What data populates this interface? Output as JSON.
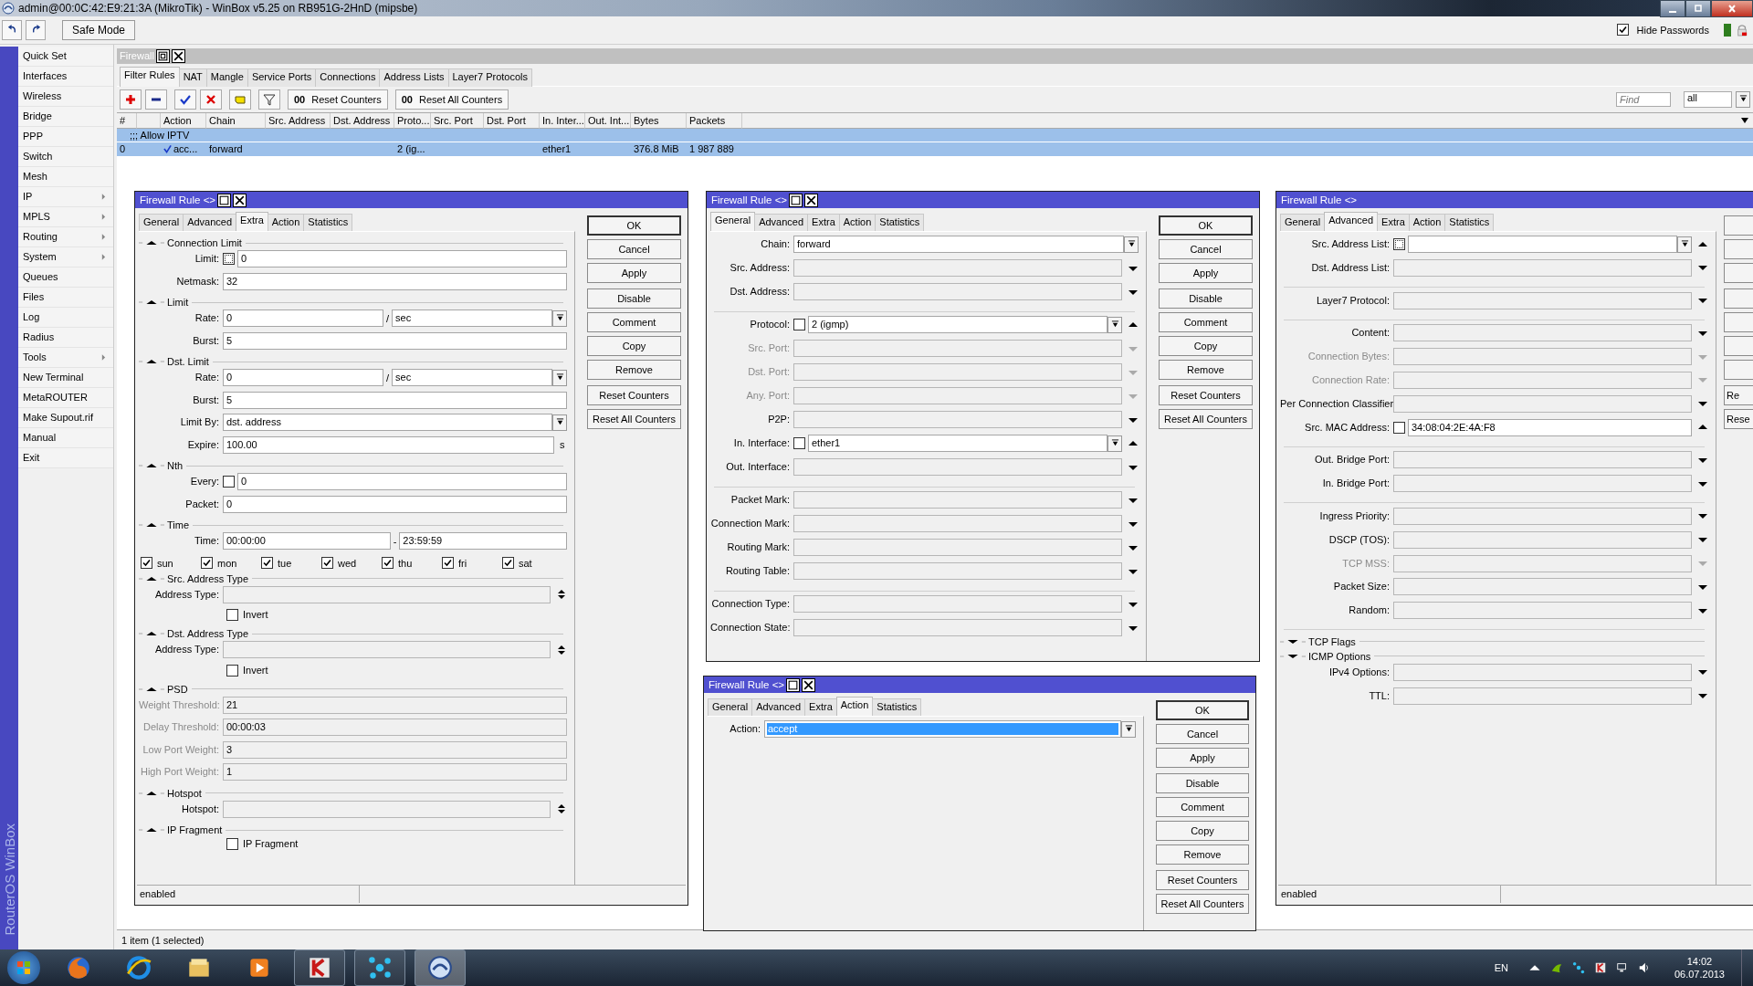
{
  "app_window": {
    "title": "admin@00:0C:42:E9:21:3A (MikroTik) - WinBox v5.25 on RB951G-2HnD (mipsbe)"
  },
  "toolbar": {
    "safe_mode": "Safe Mode",
    "hide_passwords": {
      "label": "Hide Passwords",
      "checked": true
    }
  },
  "sidebar": {
    "brand": "RouterOS WinBox",
    "items": [
      {
        "label": "Quick Set",
        "submenu": false
      },
      {
        "label": "Interfaces",
        "submenu": false
      },
      {
        "label": "Wireless",
        "submenu": false
      },
      {
        "label": "Bridge",
        "submenu": false
      },
      {
        "label": "PPP",
        "submenu": false
      },
      {
        "label": "Switch",
        "submenu": false
      },
      {
        "label": "Mesh",
        "submenu": false
      },
      {
        "label": "IP",
        "submenu": true
      },
      {
        "label": "MPLS",
        "submenu": true
      },
      {
        "label": "Routing",
        "submenu": true
      },
      {
        "label": "System",
        "submenu": true
      },
      {
        "label": "Queues",
        "submenu": false
      },
      {
        "label": "Files",
        "submenu": false
      },
      {
        "label": "Log",
        "submenu": false
      },
      {
        "label": "Radius",
        "submenu": false
      },
      {
        "label": "Tools",
        "submenu": true
      },
      {
        "label": "New Terminal",
        "submenu": false
      },
      {
        "label": "MetaROUTER",
        "submenu": false
      },
      {
        "label": "Make Supout.rif",
        "submenu": false
      },
      {
        "label": "Manual",
        "submenu": false
      },
      {
        "label": "Exit",
        "submenu": false
      }
    ]
  },
  "firewall": {
    "title": "Firewall",
    "tabs": [
      {
        "label": "Filter Rules",
        "selected": true
      },
      {
        "label": "NAT",
        "selected": false
      },
      {
        "label": "Mangle",
        "selected": false
      },
      {
        "label": "Service Ports",
        "selected": false
      },
      {
        "label": "Connections",
        "selected": false
      },
      {
        "label": "Address Lists",
        "selected": false
      },
      {
        "label": "Layer7 Protocols",
        "selected": false
      }
    ],
    "counter_buttons": [
      {
        "icon_text": "00",
        "label": "Reset Counters"
      },
      {
        "icon_text": "00",
        "label": "Reset All Counters"
      }
    ],
    "find": {
      "placeholder": "Find"
    },
    "filter": "all",
    "table": {
      "columns": [
        "#",
        null,
        "Action",
        "Chain",
        "Src. Address",
        "Dst. Address",
        "Proto...",
        "Src. Port",
        "Dst. Port",
        "In. Inter...",
        "Out. Int...",
        "Bytes",
        "Packets"
      ],
      "rows": [
        {
          "comment": ";;; Allow IPTV",
          "selected": true,
          "cells": [
            "0",
            null,
            "acc...",
            "forward",
            null,
            null,
            "2 (ig...",
            null,
            null,
            "ether1",
            null,
            "376.8 MiB",
            "1 987 889"
          ]
        }
      ]
    },
    "status": "1 item (1 selected)"
  },
  "dialogs": [
    {
      "title": "Firewall Rule <>",
      "clipped": false,
      "tabs": [
        {
          "label": "General",
          "selected": false
        },
        {
          "label": "Advanced",
          "selected": false
        },
        {
          "label": "Extra",
          "selected": true
        },
        {
          "label": "Action",
          "selected": false
        },
        {
          "label": "Statistics",
          "selected": false
        }
      ],
      "rows": [
        {
          "kind": "section",
          "label": "Connection Limit",
          "expanded": true
        },
        {
          "kind": "field",
          "label": "Limit:",
          "invert": {
            "checked": false,
            "kind": "dotted"
          },
          "value": "0"
        },
        {
          "kind": "field",
          "label": "Netmask:",
          "value": "32"
        },
        {
          "kind": "section",
          "label": "Limit",
          "expanded": true
        },
        {
          "kind": "field",
          "label": "Rate:",
          "value": "0",
          "separator": "/",
          "value2": "sec",
          "dropdown": true
        },
        {
          "kind": "field",
          "label": "Burst:",
          "value": "5"
        },
        {
          "kind": "section",
          "label": "Dst. Limit",
          "expanded": true
        },
        {
          "kind": "field",
          "label": "Rate:",
          "value": "0",
          "separator": "/",
          "value2": "sec",
          "dropdown": true
        },
        {
          "kind": "field",
          "label": "Burst:",
          "value": "5"
        },
        {
          "kind": "field",
          "label": "Limit By:",
          "value": "dst. address",
          "dropdown": true
        },
        {
          "kind": "field",
          "label": "Expire:",
          "value": "100.00",
          "unit": "s"
        },
        {
          "kind": "section",
          "label": "Nth",
          "expanded": true
        },
        {
          "kind": "field",
          "label": "Every:",
          "invert": {
            "checked": false,
            "kind": "plain"
          },
          "value": "0"
        },
        {
          "kind": "field",
          "label": "Packet:",
          "value": "0"
        },
        {
          "kind": "section",
          "label": "Time",
          "expanded": true
        },
        {
          "kind": "field",
          "label": "Time:",
          "value": "00:00:00",
          "separator": "-",
          "value2": "23:59:59"
        },
        {
          "kind": "days",
          "days": [
            {
              "label": "sun",
              "checked": true
            },
            {
              "label": "mon",
              "checked": true
            },
            {
              "label": "tue",
              "checked": true
            },
            {
              "label": "wed",
              "checked": true
            },
            {
              "label": "thu",
              "checked": true
            },
            {
              "label": "fri",
              "checked": true
            },
            {
              "label": "sat",
              "checked": true
            }
          ]
        },
        {
          "kind": "section",
          "label": "Src. Address Type",
          "expanded": true
        },
        {
          "kind": "field",
          "label": "Address Type:",
          "arrow": {
            "kind": "updown"
          }
        },
        {
          "kind": "checkbox",
          "label": "Invert",
          "checked": false
        },
        {
          "kind": "section",
          "label": "Dst. Address Type",
          "expanded": true
        },
        {
          "kind": "field",
          "label": "Address Type:",
          "arrow": {
            "kind": "updown"
          }
        },
        {
          "kind": "checkbox",
          "label": "Invert",
          "checked": false
        },
        {
          "kind": "section",
          "label": "PSD",
          "expanded": true
        },
        {
          "kind": "field",
          "label": "Weight Threshold:",
          "value": "21",
          "disabled": true
        },
        {
          "kind": "field",
          "label": "Delay Threshold:",
          "value": "00:00:03",
          "disabled": true
        },
        {
          "kind": "field",
          "label": "Low Port Weight:",
          "value": "3",
          "disabled": true
        },
        {
          "kind": "field",
          "label": "High Port Weight:",
          "value": "1",
          "disabled": true
        },
        {
          "kind": "section",
          "label": "Hotspot",
          "expanded": true
        },
        {
          "kind": "field",
          "label": "Hotspot:",
          "arrow": {
            "kind": "updown"
          }
        },
        {
          "kind": "section",
          "label": "IP Fragment",
          "expanded": true
        },
        {
          "kind": "checkbox",
          "label": "IP Fragment",
          "checked": false
        }
      ],
      "button_groups": [
        [
          {
            "label": "OK"
          },
          {
            "label": "Cancel"
          },
          {
            "label": "Apply"
          }
        ],
        [
          {
            "label": "Disable"
          },
          {
            "label": "Comment"
          },
          {
            "label": "Copy"
          },
          {
            "label": "Remove"
          }
        ],
        [
          {
            "label": "Reset Counters"
          },
          {
            "label": "Reset All Counters"
          }
        ]
      ],
      "status": "enabled"
    },
    {
      "title": "Firewall Rule <>",
      "clipped": false,
      "tabs": [
        {
          "label": "General",
          "selected": true
        },
        {
          "label": "Advanced",
          "selected": false
        },
        {
          "label": "Extra",
          "selected": false
        },
        {
          "label": "Action",
          "selected": false
        },
        {
          "label": "Statistics",
          "selected": false
        }
      ],
      "rows": [
        {
          "kind": "field",
          "label": "Chain:",
          "value": "forward",
          "dropdown": true
        },
        {
          "kind": "field",
          "label": "Src. Address:",
          "arrow": {
            "kind": "down"
          }
        },
        {
          "kind": "field",
          "label": "Dst. Address:",
          "arrow": {
            "kind": "down"
          }
        },
        {
          "kind": "rule"
        },
        {
          "kind": "field",
          "label": "Protocol:",
          "invert": {
            "checked": false,
            "kind": "plain"
          },
          "value": "2 (igmp)",
          "dropdown": true,
          "arrow": {
            "kind": "up"
          }
        },
        {
          "kind": "field",
          "label": "Src. Port:",
          "arrow": {
            "kind": "down"
          },
          "disabled": true
        },
        {
          "kind": "field",
          "label": "Dst. Port:",
          "arrow": {
            "kind": "down"
          },
          "disabled": true
        },
        {
          "kind": "field",
          "label": "Any. Port:",
          "arrow": {
            "kind": "down"
          },
          "disabled": true
        },
        {
          "kind": "field",
          "label": "P2P:",
          "arrow": {
            "kind": "down"
          }
        },
        {
          "kind": "field",
          "label": "In. Interface:",
          "invert": {
            "checked": false,
            "kind": "plain"
          },
          "value": "ether1",
          "dropdown": true,
          "arrow": {
            "kind": "up"
          }
        },
        {
          "kind": "field",
          "label": "Out. Interface:",
          "arrow": {
            "kind": "down"
          }
        },
        {
          "kind": "rule"
        },
        {
          "kind": "field",
          "label": "Packet Mark:",
          "arrow": {
            "kind": "down"
          }
        },
        {
          "kind": "field",
          "label": "Connection Mark:",
          "arrow": {
            "kind": "down"
          }
        },
        {
          "kind": "field",
          "label": "Routing Mark:",
          "arrow": {
            "kind": "down"
          }
        },
        {
          "kind": "field",
          "label": "Routing Table:",
          "arrow": {
            "kind": "down"
          }
        },
        {
          "kind": "rule"
        },
        {
          "kind": "field",
          "label": "Connection Type:",
          "arrow": {
            "kind": "down"
          }
        },
        {
          "kind": "field",
          "label": "Connection State:",
          "arrow": {
            "kind": "down"
          }
        }
      ],
      "button_groups": [
        [
          {
            "label": "OK"
          },
          {
            "label": "Cancel"
          },
          {
            "label": "Apply"
          }
        ],
        [
          {
            "label": "Disable"
          },
          {
            "label": "Comment"
          },
          {
            "label": "Copy"
          },
          {
            "label": "Remove"
          }
        ],
        [
          {
            "label": "Reset Counters"
          },
          {
            "label": "Reset All Counters"
          }
        ]
      ]
    },
    {
      "title": "Firewall Rule <>",
      "clipped": true,
      "tabs": [
        {
          "label": "General",
          "selected": false
        },
        {
          "label": "Advanced",
          "selected": true
        },
        {
          "label": "Extra",
          "selected": false
        },
        {
          "label": "Action",
          "selected": false
        },
        {
          "label": "Statistics",
          "selected": false
        }
      ],
      "rows": [
        {
          "kind": "field",
          "label": "Src. Address List:",
          "invert": {
            "checked": false,
            "kind": "dotted"
          },
          "dropdown": true,
          "arrow": {
            "kind": "up"
          }
        },
        {
          "kind": "field",
          "label": "Dst. Address List:",
          "arrow": {
            "kind": "down"
          }
        },
        {
          "kind": "rule"
        },
        {
          "kind": "field",
          "label": "Layer7 Protocol:",
          "arrow": {
            "kind": "down"
          }
        },
        {
          "kind": "rule"
        },
        {
          "kind": "field",
          "label": "Content:",
          "arrow": {
            "kind": "down"
          }
        },
        {
          "kind": "field",
          "label": "Connection Bytes:",
          "arrow": {
            "kind": "down"
          },
          "disabled": true
        },
        {
          "kind": "field",
          "label": "Connection Rate:",
          "arrow": {
            "kind": "down"
          },
          "disabled": true
        },
        {
          "kind": "field",
          "label": "Per Connection Classifier:",
          "arrow": {
            "kind": "down"
          }
        },
        {
          "kind": "field",
          "label": "Src. MAC Address:",
          "invert": {
            "checked": false,
            "kind": "plain"
          },
          "value": "34:08:04:2E:4A:F8",
          "arrow": {
            "kind": "up"
          }
        },
        {
          "kind": "rule"
        },
        {
          "kind": "field",
          "label": "Out. Bridge Port:",
          "arrow": {
            "kind": "down"
          }
        },
        {
          "kind": "field",
          "label": "In. Bridge Port:",
          "arrow": {
            "kind": "down"
          }
        },
        {
          "kind": "rule"
        },
        {
          "kind": "field",
          "label": "Ingress Priority:",
          "arrow": {
            "kind": "down"
          }
        },
        {
          "kind": "field",
          "label": "DSCP (TOS):",
          "arrow": {
            "kind": "down"
          }
        },
        {
          "kind": "field",
          "label": "TCP MSS:",
          "arrow": {
            "kind": "down"
          },
          "disabled": true
        },
        {
          "kind": "field",
          "label": "Packet Size:",
          "arrow": {
            "kind": "down"
          }
        },
        {
          "kind": "field",
          "label": "Random:",
          "arrow": {
            "kind": "down"
          }
        },
        {
          "kind": "rule"
        },
        {
          "kind": "section",
          "label": "TCP Flags",
          "expanded": false
        },
        {
          "kind": "section",
          "label": "ICMP Options",
          "expanded": false
        },
        {
          "kind": "field",
          "label": "IPv4 Options:",
          "arrow": {
            "kind": "down"
          }
        },
        {
          "kind": "field",
          "label": "TTL:",
          "arrow": {
            "kind": "down"
          }
        }
      ],
      "button_groups": [
        [
          {
            "kind": "blank"
          },
          {
            "kind": "blank"
          },
          {
            "kind": "blank"
          }
        ],
        [
          {
            "kind": "blank"
          },
          {
            "kind": "blank"
          },
          {
            "kind": "blank"
          },
          {
            "kind": "blank"
          }
        ],
        [
          {
            "label": "Re"
          },
          {
            "label": "Rese"
          }
        ]
      ],
      "status": "enabled"
    },
    {
      "title": "Firewall Rule <>",
      "clipped": false,
      "tabs": [
        {
          "label": "General",
          "selected": false
        },
        {
          "label": "Advanced",
          "selected": false
        },
        {
          "label": "Extra",
          "selected": false
        },
        {
          "label": "Action",
          "selected": true
        },
        {
          "label": "Statistics",
          "selected": false
        }
      ],
      "rows": [
        {
          "kind": "field",
          "label": "Action:",
          "value": "accept",
          "dropdown": true,
          "highlighted": true
        }
      ],
      "button_groups": [
        [
          {
            "label": "OK"
          },
          {
            "label": "Cancel"
          },
          {
            "label": "Apply"
          }
        ],
        [
          {
            "label": "Disable"
          },
          {
            "label": "Comment"
          },
          {
            "label": "Copy"
          },
          {
            "label": "Remove"
          }
        ],
        [
          {
            "label": "Reset Counters"
          },
          {
            "label": "Reset All Counters"
          }
        ]
      ]
    }
  ],
  "taskbar": {
    "apps": [
      {
        "running": false,
        "selected": false
      },
      {
        "running": false,
        "selected": false
      },
      {
        "running": false,
        "selected": false
      },
      {
        "running": false,
        "selected": false
      },
      {
        "running": true,
        "selected": false
      },
      {
        "running": true,
        "selected": false
      },
      {
        "running": true,
        "selected": true
      }
    ],
    "language": "EN",
    "time": "14:02",
    "date": "06.07.2013"
  }
}
